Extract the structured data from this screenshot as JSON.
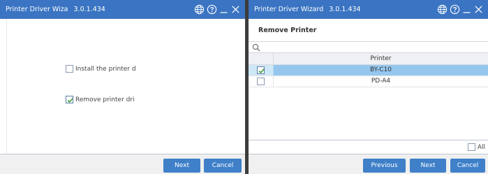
{
  "left_window": {
    "title": "Printer Driver Wiza",
    "version": "3.0.1.434",
    "options": [
      {
        "label": "Install the printer d",
        "checked": false
      },
      {
        "label": "Remove printer dri",
        "checked": true
      }
    ],
    "next_label": "Next",
    "cancel_label": "Cancel"
  },
  "right_window": {
    "title": "Printer Driver Wizard",
    "version": "3.0.1.434",
    "heading": "Remove Printer",
    "search_placeholder": "",
    "column_header": "Printer",
    "printers": [
      {
        "name": "BY-C10",
        "checked": true,
        "selected": true
      },
      {
        "name": "PD-A4",
        "checked": false,
        "selected": false
      }
    ],
    "all_label": "All",
    "all_checked": false,
    "previous_label": "Previous",
    "next_label": "Next",
    "cancel_label": "Cancel"
  },
  "colors": {
    "titlebar": "#3a74c2",
    "button": "#3f80c9",
    "selected_row": "#95c7ee",
    "check": "#3a9a3a"
  },
  "icons": [
    "globe-icon",
    "help-icon",
    "minimize-icon",
    "close-icon",
    "search-icon",
    "checkmark-icon"
  ]
}
